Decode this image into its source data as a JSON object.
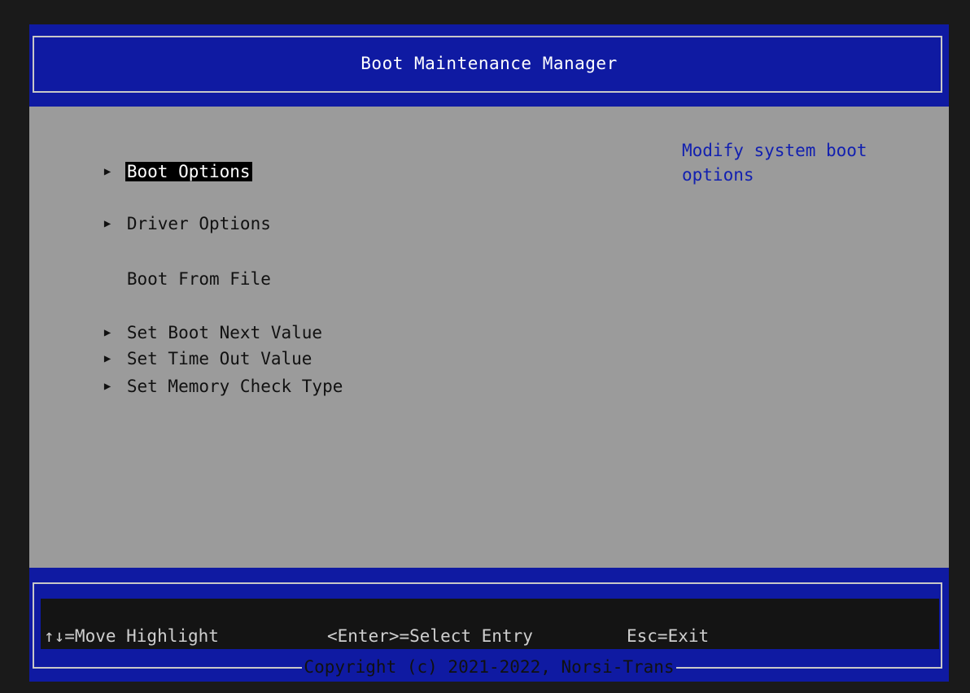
{
  "header": {
    "title": "Boot Maintenance Manager"
  },
  "menu": {
    "items": [
      {
        "label": "Boot Options",
        "has_submenu": true,
        "selected": true
      },
      {
        "label": "Driver Options",
        "has_submenu": true,
        "selected": false
      },
      {
        "label": "Boot From File",
        "has_submenu": false,
        "selected": false
      },
      {
        "label": "Set Boot Next Value",
        "has_submenu": true,
        "selected": false
      },
      {
        "label": "Set Time Out Value",
        "has_submenu": true,
        "selected": false
      },
      {
        "label": "Set Memory Check Type",
        "has_submenu": true,
        "selected": false
      }
    ]
  },
  "help": {
    "text": "Modify system boot options"
  },
  "footer": {
    "hints": {
      "move": "↑↓=Move Highlight",
      "select": "<Enter>=Select Entry",
      "exit": "Esc=Exit"
    },
    "copyright": "Copyright (c) 2021-2022, Norsi-Trans"
  },
  "colors": {
    "header_bg": "#0f1aa2",
    "body_bg": "#9b9b9b",
    "help_text": "#1220b0",
    "selection_bg": "#000000"
  },
  "icons": {
    "submenu": "right-triangle-icon"
  }
}
